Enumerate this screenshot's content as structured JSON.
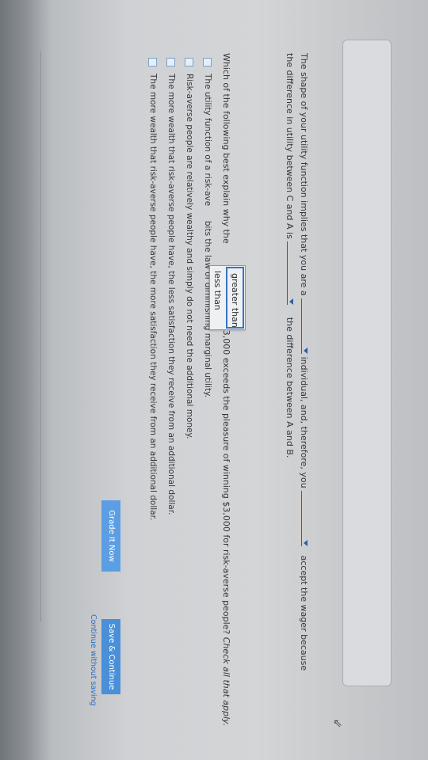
{
  "line1": {
    "text_a": "The shape of your utility function implies that you are a",
    "text_b": "individual, and, therefore, you",
    "text_c": "accept the wager because"
  },
  "line2": {
    "text_a": "the difference in utility between C and A is",
    "text_b": "the difference between A and B."
  },
  "dropdown": {
    "options": [
      "greater than",
      "less than"
    ],
    "selected": "greater than"
  },
  "question": {
    "text": "Which of the following best explain why the",
    "tail": "$3,000 exceeds the pleasure of winning $3,000 for risk-averse people?",
    "instruction": "Check all that apply."
  },
  "options": [
    {
      "label": "The utility function of a risk-ave",
      "tail": "bits the law of diminishing marginal utility."
    },
    {
      "label": "Risk-averse people are relatively wealthy and simply do not need the additional money."
    },
    {
      "label": "The more wealth that risk-averse people have, the less satisfaction they receive from an additional dollar."
    },
    {
      "label": "The more wealth that risk-averse people have, the more satisfaction they receive from an additional dollar."
    }
  ],
  "buttons": {
    "grade": "Grade It Now",
    "save": "Save & Continue",
    "continue": "Continue without saving"
  },
  "colors": {
    "button": "#4a90d9",
    "link": "#2d6dbf",
    "accent": "#2b5fa6"
  }
}
